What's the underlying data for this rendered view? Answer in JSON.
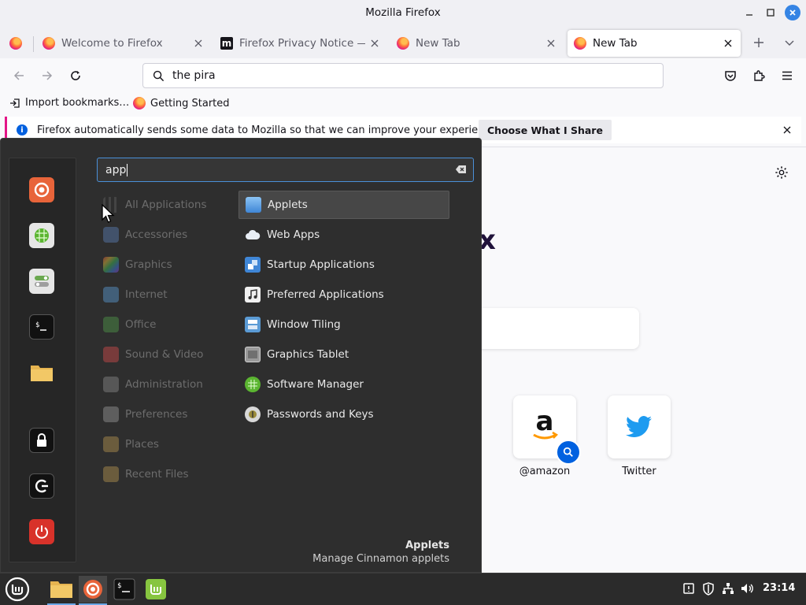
{
  "window": {
    "title": "Mozilla Firefox"
  },
  "tabs": [
    {
      "label": "",
      "icon": "firefox-icon"
    },
    {
      "label": "Welcome to Firefox",
      "icon": "firefox-icon"
    },
    {
      "label": "Firefox Privacy Notice — Mo",
      "icon": "mozilla-m-icon"
    },
    {
      "label": "New Tab",
      "icon": "firefox-icon"
    },
    {
      "label": "New Tab",
      "icon": "firefox-icon",
      "active": true
    }
  ],
  "urlbar": {
    "value": "the pira"
  },
  "bookmarks": [
    {
      "label": "Import bookmarks…",
      "icon": "import-icon"
    },
    {
      "label": "Getting Started",
      "icon": "firefox-icon"
    }
  ],
  "notification": {
    "text": "Firefox automatically sends some data to Mozilla so that we can improve your experience.",
    "button": "Choose What I Share"
  },
  "newtab": {
    "logo_fragment": "x",
    "shortcuts": [
      {
        "label": "@amazon"
      },
      {
        "label": "Twitter"
      }
    ]
  },
  "menu": {
    "search_value": "app",
    "categories": [
      "All Applications",
      "Accessories",
      "Graphics",
      "Internet",
      "Office",
      "Sound & Video",
      "Administration",
      "Preferences",
      "Places",
      "Recent Files"
    ],
    "apps": [
      "Applets",
      "Web Apps",
      "Startup Applications",
      "Preferred Applications",
      "Window Tiling",
      "Graphics Tablet",
      "Software Manager",
      "Passwords and Keys"
    ],
    "selected_app": "Applets",
    "description_title": "Applets",
    "description_text": "Manage Cinnamon applets"
  },
  "taskbar": {
    "clock": "23:14"
  },
  "colors": {
    "accent": "#3584e4",
    "menu_bg": "#2e2e2e",
    "firefox_orange": "#ff7139",
    "mint_green": "#87c540"
  }
}
